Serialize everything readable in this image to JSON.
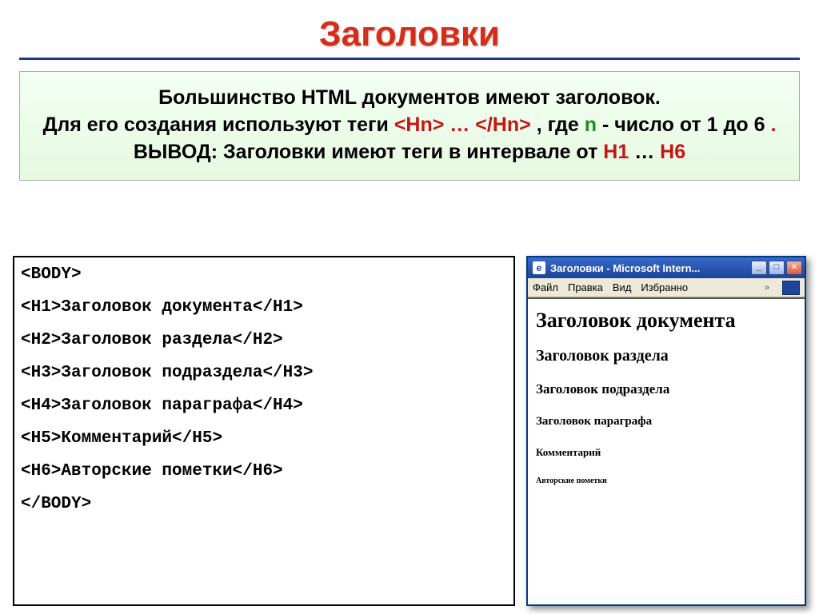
{
  "title": "Заголовки",
  "info": {
    "line1_a": "Большинство HTML документов имеют заголовок.",
    "line2_a": "Для его создания используют теги ",
    "tag_open": "<Hn>",
    "ellipsis": "…",
    "tag_close": "</Hn>",
    "line2_b": ", где ",
    "n": "n",
    "line2_c": " - число от 1 до 6",
    "period": ".",
    "line3_a": "ВЫВОД: Заголовки имеют теги в интервале от ",
    "h1": "H1",
    "to": " … ",
    "h6": "H6"
  },
  "code": {
    "l1": "<BODY>",
    "l2": "<H1>Заголовок документа</H1>",
    "l3": "<H2>Заголовок раздела</H2>",
    "l4": "<H3>Заголовок подраздела</H3>",
    "l5": "<H4>Заголовок параграфа</H4>",
    "l6": "<H5>Комментарий</H5>",
    "l7": "<H6>Авторские пометки</H6>",
    "l8": "</BODY>"
  },
  "browser": {
    "title": "Заголовки - Microsoft Intern...",
    "menu": {
      "file": "Файл",
      "edit": "Правка",
      "view": "Вид",
      "fav": "Избранно"
    },
    "h1": "Заголовок документа",
    "h2": "Заголовок раздела",
    "h3": "Заголовок подраздела",
    "h4": "Заголовок параграфа",
    "h5": "Комментарий",
    "h6": "Авторские пометки"
  }
}
